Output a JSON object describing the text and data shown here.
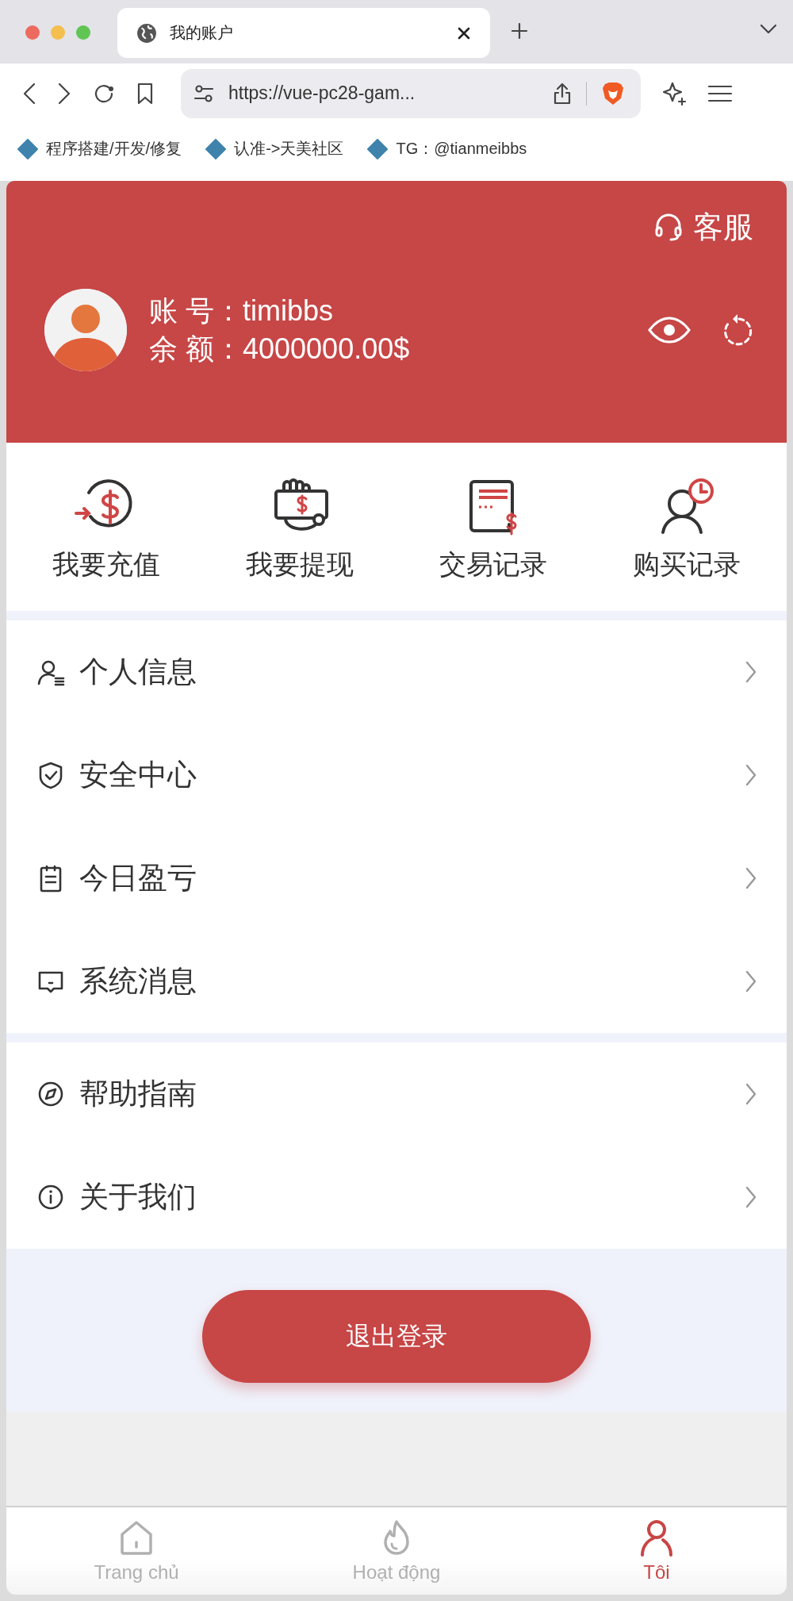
{
  "browser": {
    "tab": {
      "title": "我的账户"
    },
    "address": "https://vue-pc28-gam...",
    "bookmarks": [
      "程序搭建/开发/修复",
      "认准->天美社区",
      "TG：@tianmeibbs"
    ]
  },
  "header": {
    "service": "客服",
    "account_label": "账 号：",
    "account": "timibbs",
    "balance_label": "余 额：",
    "balance": "4000000.00$"
  },
  "actions": [
    {
      "label": "我要充值",
      "kind": "deposit"
    },
    {
      "label": "我要提现",
      "kind": "withdraw"
    },
    {
      "label": "交易记录",
      "kind": "transactions"
    },
    {
      "label": "购买记录",
      "kind": "purchases"
    }
  ],
  "menu_groups": [
    [
      {
        "label": "个人信息",
        "kind": "profile"
      },
      {
        "label": "安全中心",
        "kind": "security"
      },
      {
        "label": "今日盈亏",
        "kind": "report"
      },
      {
        "label": "系统消息",
        "kind": "message"
      }
    ],
    [
      {
        "label": "帮助指南",
        "kind": "guide"
      },
      {
        "label": "关于我们",
        "kind": "about"
      }
    ]
  ],
  "logout": "退出登录",
  "nav": [
    {
      "label": "Trang chủ",
      "kind": "home",
      "selected": false
    },
    {
      "label": "Hoạt động",
      "kind": "activity",
      "selected": false
    },
    {
      "label": "Tôi",
      "kind": "me",
      "selected": true
    }
  ]
}
